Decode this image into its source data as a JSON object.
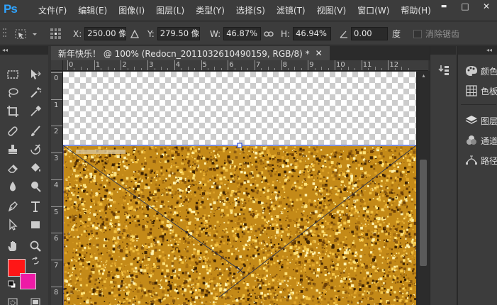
{
  "app": {
    "logo": "Ps"
  },
  "menu": [
    "文件(F)",
    "编辑(E)",
    "图像(I)",
    "图层(L)",
    "类型(Y)",
    "选择(S)",
    "滤镜(T)",
    "视图(V)",
    "窗口(W)",
    "帮助(H)"
  ],
  "window_controls": {
    "minimize": "▬",
    "restore": "□",
    "close": "✕"
  },
  "options": {
    "x_label": "X:",
    "x_value": "250.00 像",
    "y_label": "Y:",
    "y_value": "279.50 像",
    "w_label": "W:",
    "w_value": "46.87%",
    "h_label": "H:",
    "h_value": "46.94%",
    "angle_value": "0.00",
    "angle_unit": "度",
    "antialias_label": "消除锯齿"
  },
  "document": {
    "tab_title": "新年快乐！ @ 100% (Redocn_2011032610490159, RGB/8) *",
    "close": "✕",
    "ruler_h": [
      "0",
      "1",
      "2",
      "3",
      "4",
      "5",
      "6",
      "7",
      "8",
      "9",
      "10",
      "11",
      "12"
    ],
    "ruler_v": [
      "0",
      "1",
      "2",
      "3",
      "4",
      "5",
      "6",
      "7",
      "8"
    ]
  },
  "panels": {
    "color": "颜色",
    "swatches": "色板",
    "layers": "图层",
    "channels": "通道",
    "paths": "路径"
  },
  "colors": {
    "foreground": "#ff1616",
    "background": "#ee1aa6",
    "accent": "#2fa3ff"
  }
}
